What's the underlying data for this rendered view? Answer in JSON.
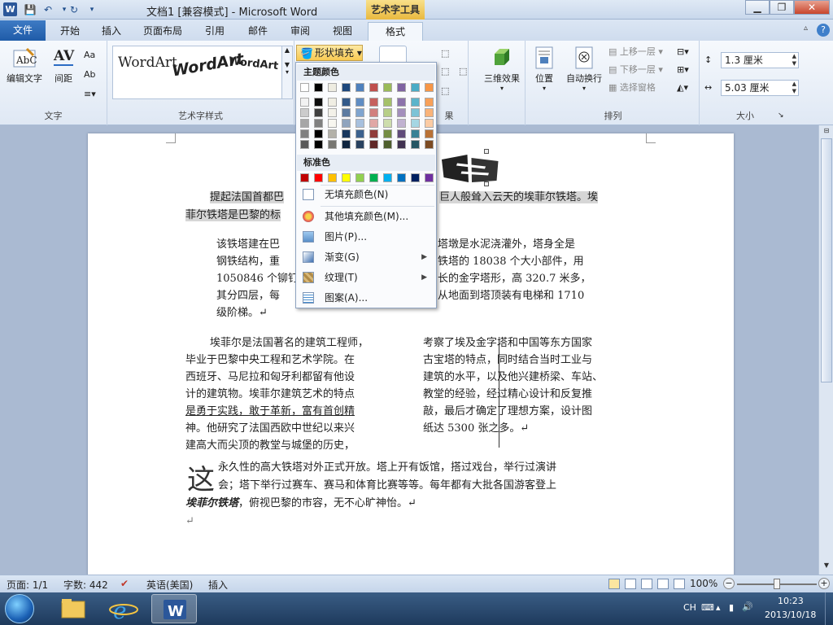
{
  "titlebar": {
    "doc_title": "文档1 [兼容模式] - Microsoft Word",
    "context_tab_title": "艺术字工具"
  },
  "tabs": {
    "file": "文件",
    "home": "开始",
    "insert": "插入",
    "page_layout": "页面布局",
    "references": "引用",
    "mailings": "邮件",
    "review": "审阅",
    "view": "视图",
    "format": "格式"
  },
  "ribbon": {
    "text_group": {
      "edit_text": "编辑文字",
      "spacing": "间距",
      "label": "文字"
    },
    "wordart_styles": {
      "items": [
        "WordArt",
        "WordArt",
        "WordArt"
      ],
      "label": "艺术字样式"
    },
    "shape_fill_button": "形状填充",
    "shape_group_label_tail": "果",
    "three_d": {
      "effects": "三维效果"
    },
    "arrange": {
      "position": "位置",
      "wrap_text": "自动换行",
      "bring_forward": "上移一层",
      "send_backward": "下移一层",
      "selection_pane": "选择窗格",
      "label": "排列"
    },
    "size": {
      "height": "1.3 厘米",
      "width": "5.03 厘米",
      "label": "大小"
    }
  },
  "fill_menu": {
    "theme_colors_header": "主题颜色",
    "standard_colors_header": "标准色",
    "no_fill": "无填充颜色(N)",
    "more_colors": "其他填充颜色(M)...",
    "picture": "图片(P)...",
    "gradient": "渐变(G)",
    "texture": "纹理(T)",
    "pattern": "图案(A)...",
    "theme_colors": [
      "#ffffff",
      "#000000",
      "#eeece1",
      "#1f497d",
      "#4f81bd",
      "#c0504d",
      "#9bbb59",
      "#8064a2",
      "#4bacc6",
      "#f79646"
    ],
    "standard_colors": [
      "#c00000",
      "#ff0000",
      "#ffc000",
      "#ffff00",
      "#92d050",
      "#00b050",
      "#00b0f0",
      "#0070c0",
      "#002060",
      "#7030a0"
    ]
  },
  "document": {
    "para1_line1_a": "提起法国首都巴",
    "para1_line1_b": "巨人般耸入云天的埃菲尔铁塔。埃",
    "para1_line2": "菲尔铁塔是巴黎的标",
    "para2": [
      {
        "a": "该铁塔建在巴",
        "b": "塔墩是水泥浇灌外，塔身全是"
      },
      {
        "a": "钢铁结构，重",
        "b": "铁塔的 18038 个大小部件，用"
      },
      {
        "a": "1050846 个铆钉",
        "b": "长的金字塔形，高 320.7 米多，"
      },
      {
        "a": "其分四层，每",
        "b": "从地面到塔顶装有电梯和 1710"
      },
      {
        "a": "级阶梯。↵",
        "b": ""
      }
    ],
    "col_left": [
      "埃菲尔是法国著名的建筑工程师，",
      "毕业于巴黎中央工程和艺术学院。在",
      "西班牙、马尼拉和匈牙利都留有他设",
      "计的建筑物。埃菲尔建筑艺术的特点",
      "是勇于实践，敢于革新，富有首创精",
      "神。他研究了法国西欧中世纪以来兴",
      "建高大而尖顶的教堂与城堡的历史，"
    ],
    "col_right": [
      "考察了埃及金字塔和中国等东方国家",
      "古宝塔的特点，同时结合当时工业与",
      "建筑的水平，以及他兴建桥梁、车站、",
      "教堂的经验，经过精心设计和反复推",
      "敲，最后才确定了理想方案，设计图",
      "纸达 5300 张之多。↵"
    ],
    "dropcap": "这",
    "para4_line1": "永久性的高大铁塔对外正式开放。塔上开有饭馆，搭过戏台，举行过演讲",
    "para4_line2": "会；塔下举行过赛车、赛马和体育比赛等等。每年都有大批各国游客登上",
    "para4_line3_bold": "埃菲尔铁塔",
    "para4_line3_rest": "，俯视巴黎的市容，无不心旷神怡。↵",
    "end_mark": "↵"
  },
  "statusbar": {
    "page": "页面: 1/1",
    "words": "字数: 442",
    "language": "英语(美国)",
    "mode": "插入",
    "zoom": "100%",
    "zoom_fraction": 0.5
  },
  "taskbar": {
    "ime": "CH",
    "time": "10:23",
    "date": "2013/10/18"
  }
}
